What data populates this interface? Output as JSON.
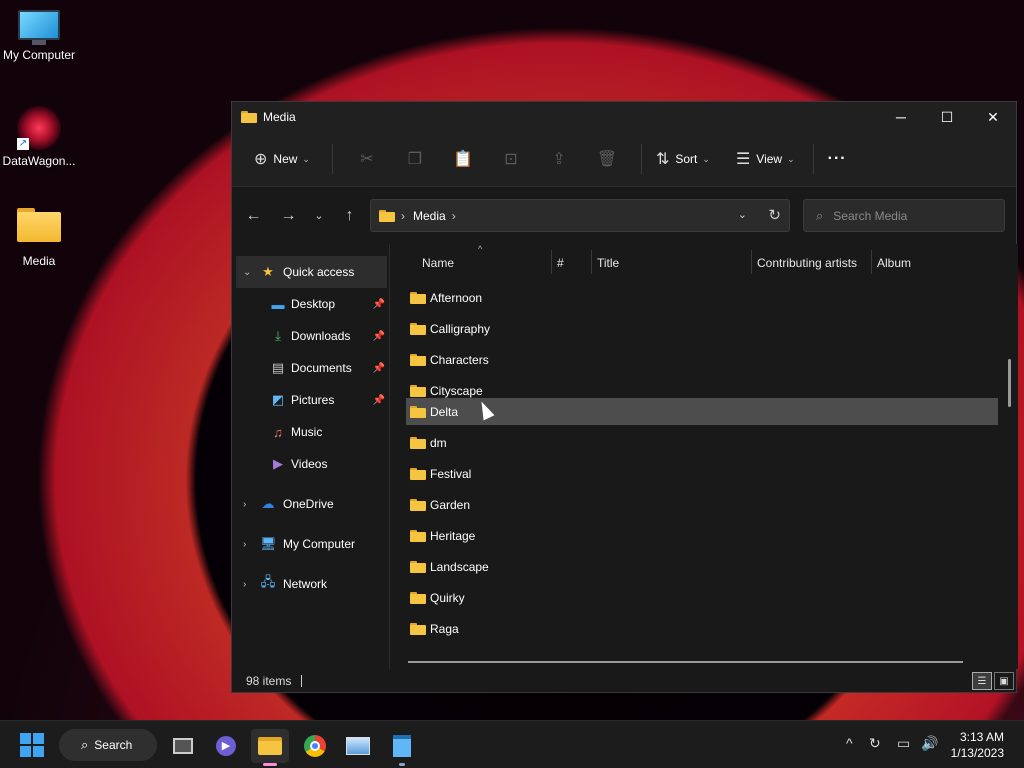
{
  "desktop": {
    "icons": [
      {
        "label": "My Computer",
        "icon": "monitor-icon"
      },
      {
        "label": "DataWagon...",
        "icon": "datawagon-app-icon"
      },
      {
        "label": "Media",
        "icon": "folder-icon"
      }
    ]
  },
  "window": {
    "title": "Media",
    "controls": {
      "minimize": "─",
      "maximize": "☐",
      "close": "✕"
    },
    "toolbar": {
      "new_label": "New",
      "sort_label": "Sort",
      "view_label": "View",
      "more_label": "···"
    },
    "address": {
      "crumbs": [
        "Media"
      ]
    },
    "search": {
      "placeholder": "Search Media"
    },
    "sidebar": {
      "quick_access": "Quick access",
      "items": [
        {
          "label": "Desktop",
          "icon": "desktop-icon",
          "pinned": true
        },
        {
          "label": "Downloads",
          "icon": "download-icon",
          "pinned": true
        },
        {
          "label": "Documents",
          "icon": "documents-icon",
          "pinned": true
        },
        {
          "label": "Pictures",
          "icon": "pictures-icon",
          "pinned": true
        },
        {
          "label": "Music",
          "icon": "music-icon",
          "pinned": false
        },
        {
          "label": "Videos",
          "icon": "videos-icon",
          "pinned": false
        }
      ],
      "roots": [
        {
          "label": "OneDrive",
          "icon": "onedrive-icon"
        },
        {
          "label": "My Computer",
          "icon": "monitor-icon"
        },
        {
          "label": "Network",
          "icon": "network-icon"
        }
      ]
    },
    "columns": [
      "Name",
      "#",
      "Title",
      "Contributing artists",
      "Album"
    ],
    "files": [
      "Afternoon",
      "Calligraphy",
      "Characters",
      "Cityscape",
      "Delta",
      "dm",
      "Festival",
      "Garden",
      "Heritage",
      "Landscape",
      "Quirky",
      "Raga"
    ],
    "hovered_file": "Delta",
    "status": {
      "items": "98 items"
    }
  },
  "taskbar": {
    "search_label": "Search",
    "time": "3:13 AM",
    "date": "1/13/2023"
  },
  "colors": {
    "accent": "#3fa5f2",
    "folder": "#f5c542",
    "window_bg": "#191919",
    "hover_row": "#4d4d4d"
  }
}
